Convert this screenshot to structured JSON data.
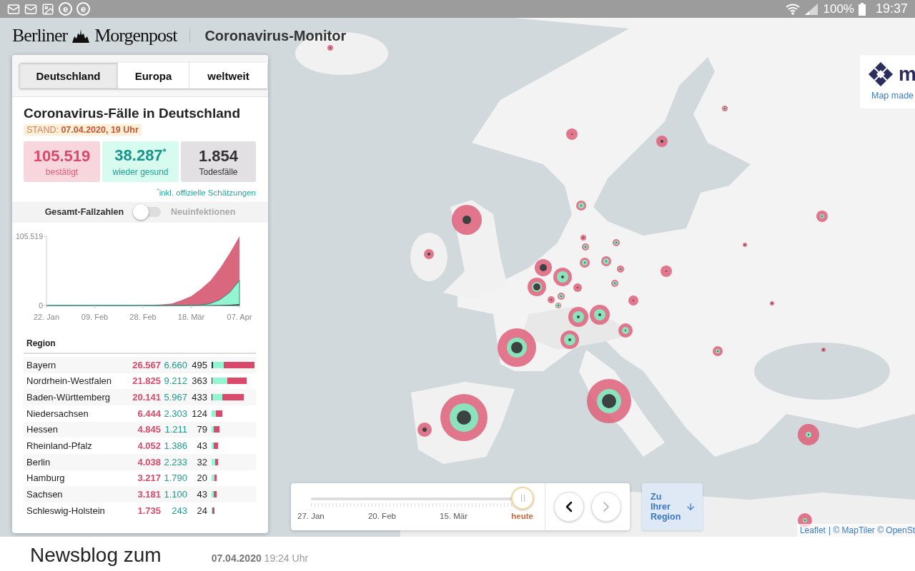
{
  "status_bar": {
    "notification_badges": [
      "e",
      "e"
    ],
    "battery": "100%",
    "time": "19:37"
  },
  "header": {
    "brand_left": "Berliner",
    "brand_right": "Morgenpost",
    "title": "Coronavirus-Monitor"
  },
  "panel": {
    "tabs": [
      {
        "label": "Deutschland",
        "selected": true
      },
      {
        "label": "Europa",
        "selected": false
      },
      {
        "label": "weltweit",
        "selected": false
      }
    ],
    "heading": "Coronavirus-Fälle in Deutschland",
    "stand": "STAND: **07.04.2020, 19 Uhr**",
    "stats": [
      {
        "kind": "confirmed",
        "value": "105.519",
        "label": "bestätigt"
      },
      {
        "kind": "recovered",
        "value": "38.287$^{*}$",
        "label": "wieder gesund"
      },
      {
        "kind": "deaths",
        "value": "1.854",
        "label": "Todesfälle"
      }
    ],
    "footnote": "$^{*}$inkl. offizielle Schätzungen",
    "toggle": {
      "left_label": "Gesamt-Fallzahlen",
      "right_label": "Neuinfektionen",
      "on": false
    },
    "chart": {
      "chart_data": {
        "type": "area",
        "categories": [
          "22. Jan",
          null,
          null,
          null,
          null,
          "09. Feb",
          null,
          null,
          null,
          null,
          "28. Feb",
          null,
          null,
          null,
          null,
          "18. Mär",
          null,
          null,
          null,
          null,
          "07. Apr"
        ],
        "series": [
          {
            "color": "#d9687e",
            "values": [
              5,
              10,
              14,
              16,
              16,
              16,
              16,
              16,
              60,
              200,
              500,
              900,
              1500,
              3000,
              8000,
              14000,
              25000,
              38000,
              57000,
              80000,
              105519
            ]
          },
          {
            "color": "#93f5d1",
            "values": [
              0,
              0,
              0,
              0,
              0,
              14,
              16,
              16,
              16,
              16,
              16,
              16,
              16,
              46,
              80,
              150,
              600,
              3000,
              9000,
              20000,
              38287
            ]
          },
          {
            "color": "#333333",
            "values": [
              0,
              0,
              0,
              0,
              0,
              0,
              0,
              0,
              0,
              0,
              0,
              0,
              0,
              2,
              10,
              30,
              100,
              300,
              700,
              1200,
              1854
            ]
          }
        ],
        "ylim": [
          0,
          105519
        ],
        "yticks": [
          0,
          {
            "value": 105519,
            "label": "105.519"
          }
        ]
      }
    },
    "table": {
      "columns": [
        "Region"
      ],
      "rows": [
        {
          "region": "Bayern",
          "confirmed": "26.567",
          "recovered": "6.660",
          "deaths": "495"
        },
        {
          "region": "Nordrhein-Westfalen",
          "confirmed": "21.825",
          "recovered": "9.212",
          "deaths": "363"
        },
        {
          "region": "Baden-Württemberg",
          "confirmed": "20.141",
          "recovered": "5.967",
          "deaths": "433"
        },
        {
          "region": "Niedersachsen",
          "confirmed": "6.444",
          "recovered": "2.303",
          "deaths": "124"
        },
        {
          "region": "Hessen",
          "confirmed": "4.845",
          "recovered": "1.211",
          "deaths": "79"
        },
        {
          "region": "Rheinland-Pfalz",
          "confirmed": "4.052",
          "recovered": "1.386",
          "deaths": "43"
        },
        {
          "region": "Berlin",
          "confirmed": "4.038",
          "recovered": "2.233",
          "deaths": "32"
        },
        {
          "region": "Hamburg",
          "confirmed": "3.217",
          "recovered": "1.790",
          "deaths": "20"
        },
        {
          "region": "Sachsen",
          "confirmed": "3.181",
          "recovered": "1.100",
          "deaths": "43"
        },
        {
          "region": "Schleswig-Holstein",
          "confirmed": "1.735",
          "recovered": "243",
          "deaths": "24"
        }
      ]
    }
  },
  "timeline": {
    "level": 1,
    "labels": [
      {
        "label": "27. Jan",
        "selected": false
      },
      {
        "label": "20. Feb",
        "selected": false
      },
      {
        "label": "15. Mär",
        "selected": false
      },
      {
        "label": "heute",
        "selected": true
      }
    ],
    "nav_buttons": [
      {
        "kind": "prev",
        "disabled": false
      },
      {
        "kind": "next",
        "disabled": true
      }
    ]
  },
  "region_button": "Zu Ihrer Region",
  "maptiler": {
    "logo_text": "m",
    "caption": "Map made"
  },
  "attribution": {
    "link": "Leaflet",
    "text": "| © MapTiler © OpenSt"
  },
  "newsblog": {
    "title": "Newsblog zum",
    "timestamp": "**07.04.2020** 19:24 Uhr"
  }
}
